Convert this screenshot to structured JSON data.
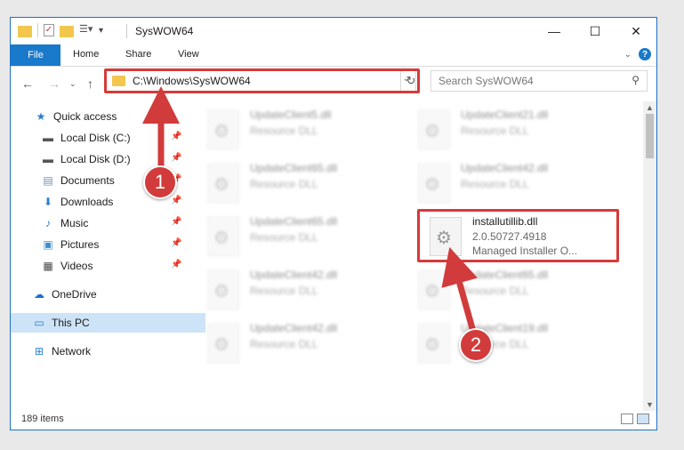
{
  "window": {
    "title": "SysWOW64",
    "controls": {
      "minimize": "—",
      "maximize": "☐",
      "close": "✕"
    }
  },
  "ribbon": {
    "tabs": [
      "File",
      "Home",
      "Share",
      "View"
    ]
  },
  "address": {
    "path": "C:\\Windows\\SysWOW64",
    "search_placeholder": "Search SysWOW64"
  },
  "sidebar": {
    "items": [
      {
        "label": "Quick access",
        "icon": "star-icon",
        "glyph": "★",
        "color": "#2b7cd3"
      },
      {
        "label": "Local Disk (C:)",
        "icon": "drive-icon",
        "glyph": "▬",
        "color": "#555555"
      },
      {
        "label": "Local Disk (D:)",
        "icon": "drive-icon",
        "glyph": "▬",
        "color": "#555555"
      },
      {
        "label": "Documents",
        "icon": "documents-icon",
        "glyph": "▤",
        "color": "#6f8fb5"
      },
      {
        "label": "Downloads",
        "icon": "downloads-icon",
        "glyph": "⬇",
        "color": "#2b7cd3"
      },
      {
        "label": "Music",
        "icon": "music-icon",
        "glyph": "♪",
        "color": "#2b7cd3"
      },
      {
        "label": "Pictures",
        "icon": "pictures-icon",
        "glyph": "▣",
        "color": "#3a8fd0"
      },
      {
        "label": "Videos",
        "icon": "videos-icon",
        "glyph": "▦",
        "color": "#444444"
      },
      {
        "label": "OneDrive",
        "icon": "onedrive-icon",
        "glyph": "☁",
        "color": "#1e6fc8"
      },
      {
        "label": "This PC",
        "icon": "pc-icon",
        "glyph": "▭",
        "color": "#2b7cd3"
      },
      {
        "label": "Network",
        "icon": "network-icon",
        "glyph": "⊞",
        "color": "#2b7cd3"
      }
    ]
  },
  "files": [
    {
      "name": "UpdateClient5.dll",
      "desc": "Resource DLL",
      "blurred": true
    },
    {
      "name": "UpdateClient21.dll",
      "desc": "Resource DLL",
      "blurred": true
    },
    {
      "name": "UpdateClient65.dll",
      "desc": "Resource DLL",
      "blurred": true
    },
    {
      "name": "UpdateClient42.dll",
      "desc": "Resource DLL",
      "blurred": true
    },
    {
      "name": "UpdateClient65.dll",
      "desc": "Resource DLL",
      "blurred": true
    },
    {
      "name": "installutillib.dll",
      "desc": "2.0.50727.4918",
      "desc2": "Managed Installer O...",
      "blurred": false
    },
    {
      "name": "UpdateClient42.dll",
      "desc": "Resource DLL",
      "blurred": true
    },
    {
      "name": "UpdateClient65.dll",
      "desc": "Resource DLL",
      "blurred": true
    },
    {
      "name": "UpdateClient42.dll",
      "desc": "Resource DLL",
      "blurred": true
    },
    {
      "name": "UpdateClient19.dll",
      "desc": "Resource DLL",
      "blurred": true
    }
  ],
  "status": {
    "item_count": "189 items"
  },
  "annotations": {
    "step1": "1",
    "step2": "2",
    "color": "#d23b3b"
  }
}
